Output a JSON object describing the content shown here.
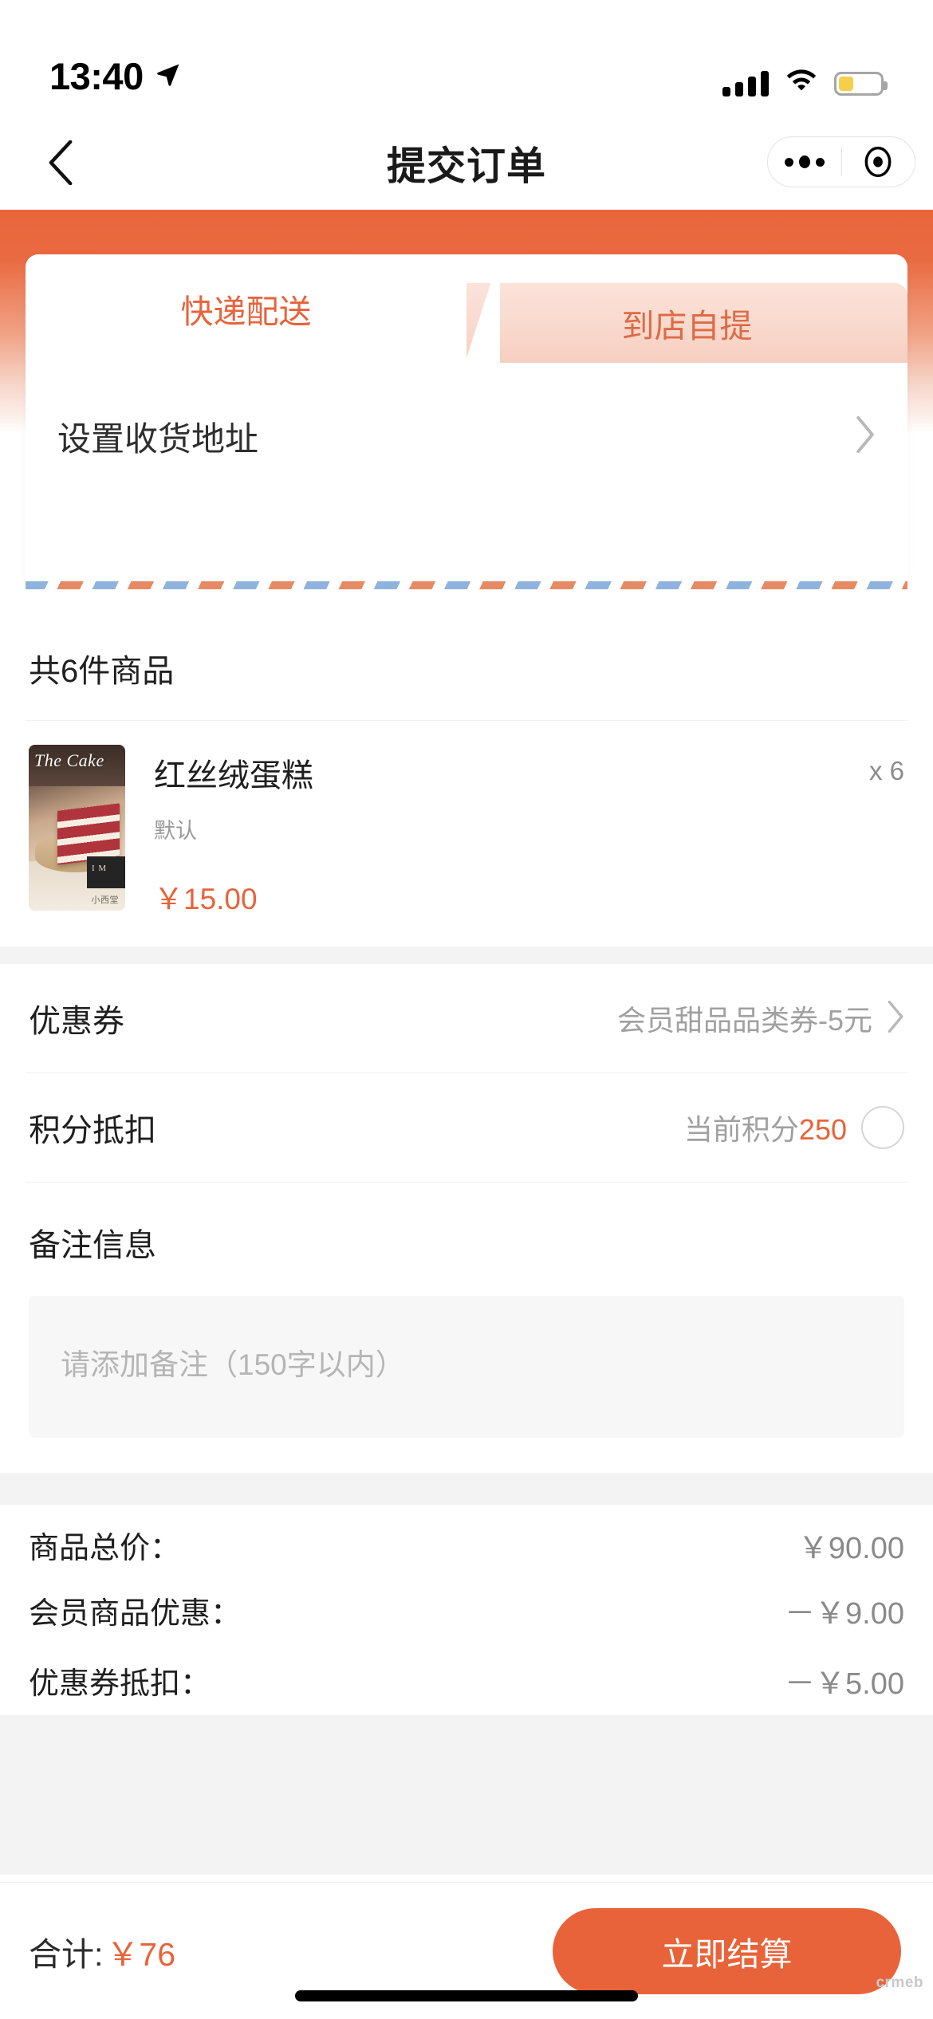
{
  "statusbar": {
    "time": "13:40",
    "location_icon": "location-arrow-icon",
    "signal_icon": "cellular-signal-icon",
    "wifi_icon": "wifi-icon",
    "battery_icon": "battery-icon",
    "battery_level_pct": 36
  },
  "navbar": {
    "back_icon": "chevron-left-icon",
    "title": "提交订单",
    "capsule": {
      "more_icon": "ellipsis-icon",
      "target_icon": "target-icon"
    }
  },
  "delivery": {
    "tabs": [
      {
        "label": "快递配送",
        "active": true
      },
      {
        "label": "到店自提",
        "active": false
      }
    ],
    "address": {
      "label": "设置收货地址",
      "chevron_icon": "chevron-right-icon"
    }
  },
  "goods": {
    "count_text": "共6件商品",
    "items": [
      {
        "name": "红丝绒蛋糕",
        "spec": "默认",
        "price": "￥15.00",
        "qty": "x 6",
        "thumb_caption": "The Cake",
        "thumb_brand": "小西堂",
        "thumb_card_text": "I M",
        "thumb_alt": "red-velvet-cake-photo"
      }
    ]
  },
  "coupon": {
    "label": "优惠券",
    "value": "会员甜品品类券-5元",
    "chevron_icon": "chevron-right-icon"
  },
  "points": {
    "label": "积分抵扣",
    "hint_label": "当前积分",
    "hint_value": "250",
    "toggle_icon": "radio-unchecked-icon",
    "checked": false
  },
  "notes": {
    "title": "备注信息",
    "placeholder": "请添加备注（150字以内）",
    "value": ""
  },
  "summary": {
    "rows": [
      {
        "label": "商品总价：",
        "value": "￥90.00"
      },
      {
        "label": "会员商品优惠：",
        "value": "－￥9.00"
      },
      {
        "label": "优惠券抵扣：",
        "value": "－￥5.00"
      }
    ]
  },
  "footer": {
    "total_label": "合计:",
    "total_value": "￥76",
    "checkout_label": "立即结算"
  },
  "watermark": "crmeb",
  "theme": {
    "accent": "#e8633a",
    "accent_soft": "#f6cfc0",
    "text_primary": "#1f1f1f",
    "text_muted": "#a0a0a0",
    "page_bg": "#f3f3f3"
  }
}
